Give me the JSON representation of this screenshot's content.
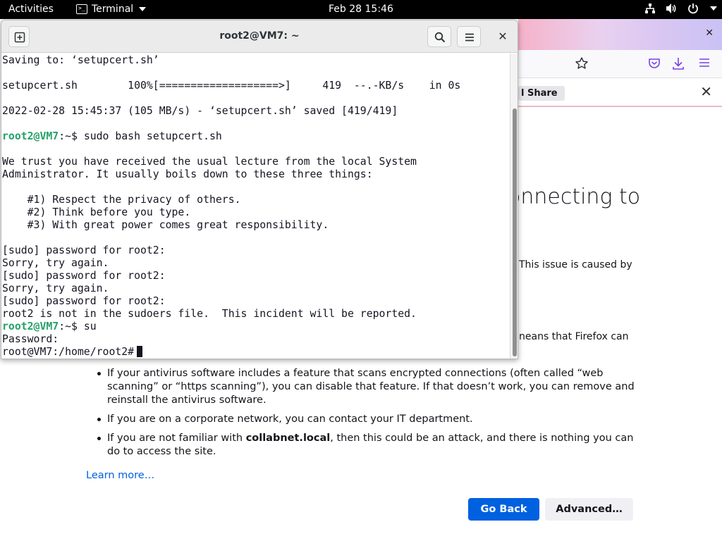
{
  "topbar": {
    "activities": "Activities",
    "app_name": "Terminal",
    "clock": "Feb 28  15:46"
  },
  "firefox": {
    "notification_button": "l Share",
    "heading_fragment": "onnecting to",
    "issue_fragment": "This issue is caused by",
    "means_fragment": "neans that Firefox can",
    "list_items": [
      {
        "pre": "If your antivirus software includes a feature that scans encrypted connections (often called “web scanning” or “https scanning”), you can disable that feature. If that doesn’t work, you can remove and reinstall the antivirus software.",
        "bold": "",
        "post": ""
      },
      {
        "pre": "If you are on a corporate network, you can contact your IT department.",
        "bold": "",
        "post": ""
      },
      {
        "pre": "If you are not familiar with ",
        "bold": "collabnet.local",
        "post": ", then this could be an attack, and there is nothing you can do to access the site."
      }
    ],
    "learn_more": "Learn more…",
    "go_back": "Go Back",
    "advanced": "Advanced…"
  },
  "terminal": {
    "title": "root2@VM7: ~",
    "lines": [
      {
        "prompt": "",
        "text": "Saving to: ‘setupcert.sh’"
      },
      {
        "prompt": "",
        "text": ""
      },
      {
        "prompt": "",
        "text": "setupcert.sh        100%[===================>]     419  --.-KB/s    in 0s"
      },
      {
        "prompt": "",
        "text": ""
      },
      {
        "prompt": "",
        "text": "2022-02-28 15:45:37 (105 MB/s) - ‘setupcert.sh’ saved [419/419]"
      },
      {
        "prompt": "",
        "text": ""
      },
      {
        "prompt": "root2@VM7",
        "text": ":~$ sudo bash setupcert.sh"
      },
      {
        "prompt": "",
        "text": ""
      },
      {
        "prompt": "",
        "text": "We trust you have received the usual lecture from the local System"
      },
      {
        "prompt": "",
        "text": "Administrator. It usually boils down to these three things:"
      },
      {
        "prompt": "",
        "text": ""
      },
      {
        "prompt": "",
        "text": "    #1) Respect the privacy of others."
      },
      {
        "prompt": "",
        "text": "    #2) Think before you type."
      },
      {
        "prompt": "",
        "text": "    #3) With great power comes great responsibility."
      },
      {
        "prompt": "",
        "text": ""
      },
      {
        "prompt": "",
        "text": "[sudo] password for root2:"
      },
      {
        "prompt": "",
        "text": "Sorry, try again."
      },
      {
        "prompt": "",
        "text": "[sudo] password for root2:"
      },
      {
        "prompt": "",
        "text": "Sorry, try again."
      },
      {
        "prompt": "",
        "text": "[sudo] password for root2:"
      },
      {
        "prompt": "",
        "text": "root2 is not in the sudoers file.  This incident will be reported."
      },
      {
        "prompt": "root2@VM7",
        "text": ":~$ su"
      },
      {
        "prompt": "",
        "text": "Password:"
      },
      {
        "prompt": "",
        "text": "root@VM7:/home/root2#",
        "cursor": true
      }
    ]
  },
  "colors": {
    "prompt_green": "#26a269",
    "firefox_blue": "#0061e0",
    "topbar": "#000000"
  }
}
